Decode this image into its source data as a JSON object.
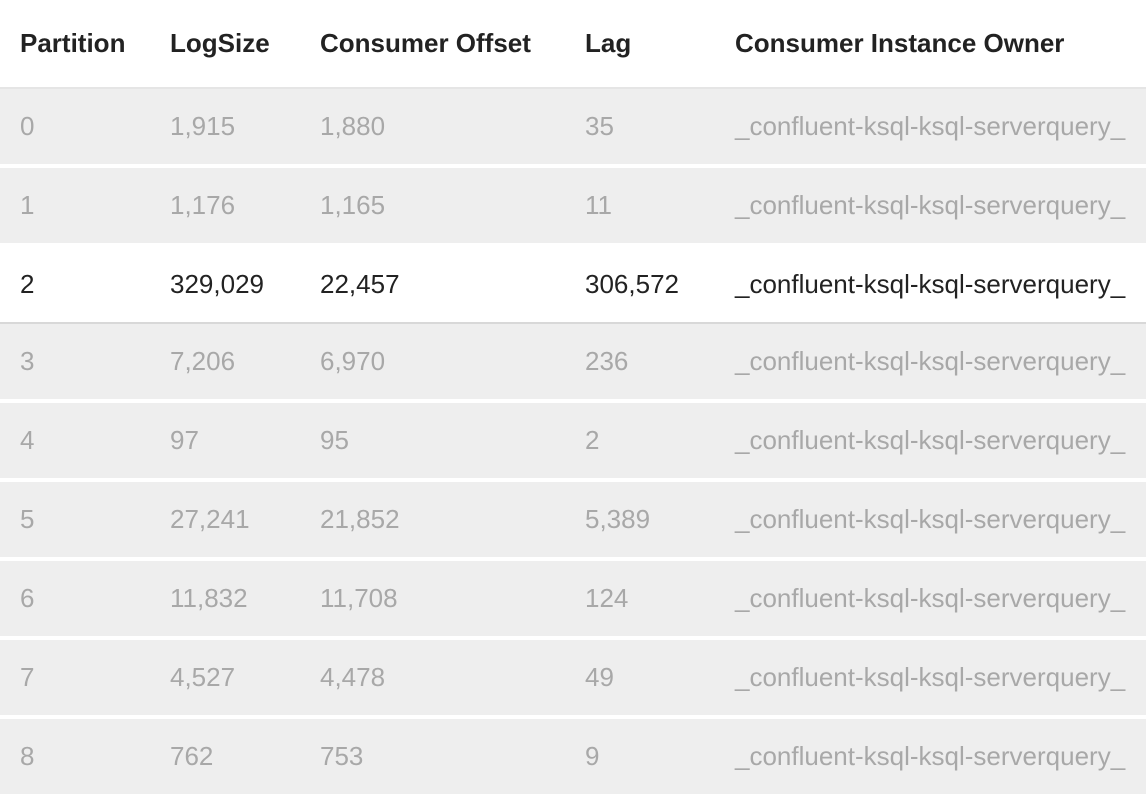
{
  "table": {
    "headers": {
      "partition": "Partition",
      "logsize": "LogSize",
      "offset": "Consumer Offset",
      "lag": "Lag",
      "owner": "Consumer Instance Owner"
    },
    "rows": [
      {
        "partition": "0",
        "logsize": "1,915",
        "offset": "1,880",
        "lag": "35",
        "owner": "_confluent-ksql-ksql-serverquery_",
        "highlight": false
      },
      {
        "partition": "1",
        "logsize": "1,176",
        "offset": "1,165",
        "lag": "11",
        "owner": "_confluent-ksql-ksql-serverquery_",
        "highlight": false
      },
      {
        "partition": "2",
        "logsize": "329,029",
        "offset": "22,457",
        "lag": "306,572",
        "owner": "_confluent-ksql-ksql-serverquery_",
        "highlight": true
      },
      {
        "partition": "3",
        "logsize": "7,206",
        "offset": "6,970",
        "lag": "236",
        "owner": "_confluent-ksql-ksql-serverquery_",
        "highlight": false
      },
      {
        "partition": "4",
        "logsize": "97",
        "offset": "95",
        "lag": "2",
        "owner": "_confluent-ksql-ksql-serverquery_",
        "highlight": false
      },
      {
        "partition": "5",
        "logsize": "27,241",
        "offset": "21,852",
        "lag": "5,389",
        "owner": "_confluent-ksql-ksql-serverquery_",
        "highlight": false
      },
      {
        "partition": "6",
        "logsize": "11,832",
        "offset": "11,708",
        "lag": "124",
        "owner": "_confluent-ksql-ksql-serverquery_",
        "highlight": false
      },
      {
        "partition": "7",
        "logsize": "4,527",
        "offset": "4,478",
        "lag": "49",
        "owner": "_confluent-ksql-ksql-serverquery_",
        "highlight": false
      },
      {
        "partition": "8",
        "logsize": "762",
        "offset": "753",
        "lag": "9",
        "owner": "_confluent-ksql-ksql-serverquery_",
        "highlight": false
      }
    ]
  }
}
